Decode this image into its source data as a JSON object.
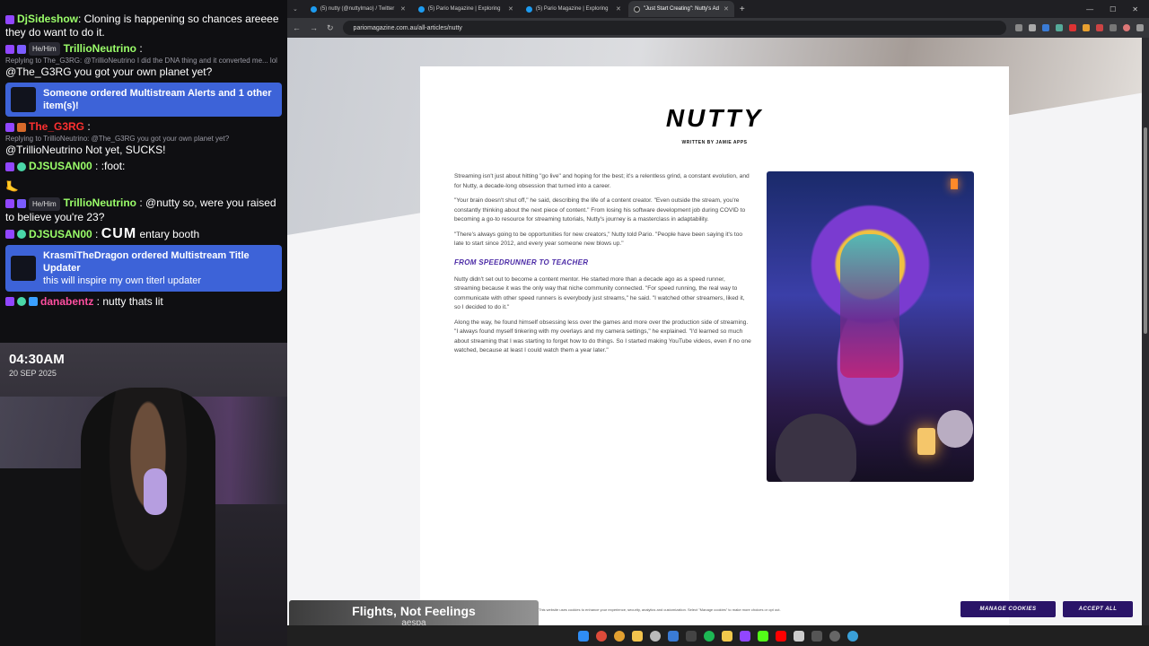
{
  "chat": {
    "messages": [
      {
        "name": "DjSideshow",
        "name_color": "#9bff6a",
        "text": ": Cloning is happening so chances areeee they do want to do it."
      },
      {
        "name": "TrillioNeutrino",
        "name_color": "#9bff6a",
        "pronoun": "He/Him",
        "text": " :"
      },
      {
        "reply": "Replying to The_G3RG: @TrillioNeutrino I did the DNA thing and it converted me... lol",
        "text": "@The_G3RG you got your own planet yet?"
      },
      {
        "name": "The_G3RG",
        "name_color": "#ff3030",
        "text": " :",
        "reply_after": "Replying to TrillioNeutrino: @The_G3RG you got your own planet yet?",
        "text2": "@TrillioNeutrino Not yet, SUCKS!"
      },
      {
        "name": "DJSUSAN00",
        "name_color": "#9bff6a",
        "text": " : :foot:"
      },
      {
        "name": "TrillioNeutrino",
        "name_color": "#9bff6a",
        "pronoun": "He/Him",
        "text": " : @nutty so, were you raised to believe you're 23?"
      },
      {
        "name": "DJSUSAN00",
        "name_color": "#9bff6a",
        "emote": "CUM",
        "text": " entary booth"
      },
      {
        "name": "danabentz",
        "name_color": "#ff4fa0",
        "text": " : nutty thats lit"
      }
    ],
    "alerts": [
      {
        "title": "Someone ordered Multistream Alerts and 1 other item(s)!",
        "sub": ""
      },
      {
        "title": "KrasmiTheDragon ordered Multistream Title Updater",
        "sub": "this will inspire my own titerl updater"
      }
    ]
  },
  "cam": {
    "time": "04:30AM",
    "date": "20 SEP 2025"
  },
  "song": {
    "title": "Flights, Not Feelings",
    "artist": "aespa"
  },
  "browser": {
    "tabs": [
      {
        "label": "(5) nutty (@nuttylmao) / Twitter",
        "active": false
      },
      {
        "label": "(5) Pario Magazine | Exploring",
        "active": false
      },
      {
        "label": "(5) Pario Magazine | Exploring",
        "active": false
      },
      {
        "label": "\"Just Start Creating\": Nutty's Ad",
        "active": true
      }
    ],
    "url": "pariomagazine.com.au/all-articles/nutty"
  },
  "article": {
    "title": "NUTTY",
    "byline": "WRITTEN BY JAMIE APPS",
    "paragraphs_1": [
      "Streaming isn't just about hitting \"go live\" and hoping for the best; it's a relentless grind, a constant evolution, and for Nutty, a decade-long obsession that turned into a career.",
      "\"Your brain doesn't shut off,\" he said, describing the life of a content creator. \"Even outside the stream, you're constantly thinking about the next piece of content.\" From losing his software development job during COVID to becoming a go-to resource for streaming tutorials, Nutty's journey is a masterclass in adaptability.",
      "\"There's always going to be opportunities for new creators,\" Nutty told Pario. \"People have been saying it's too late to start since 2012, and every year someone new blows up.\""
    ],
    "subhead": "FROM SPEEDRUNNER TO TEACHER",
    "paragraphs_2": [
      "Nutty didn't set out to become a content mentor. He started more than a decade ago as a speed runner, streaming because it was the only way that niche community connected. \"For speed running, the real way to communicate with other speed runners is everybody just streams,\" he said. \"I watched other streamers, liked it, so I decided to do it.\"",
      "Along the way, he found himself obsessing less over the games and more over the production side of streaming. \"I always found myself tinkering with my overlays and my camera settings,\" he explained. \"I'd learned so much about streaming that I was starting to forget how to do things. So I started making YouTube videos, even if no one watched, because at least I could watch them a year later.\""
    ]
  },
  "cookie": {
    "message": "This website uses cookies to enhance your experience, security, analytics and customization. Select \"Manage cookies\" to make more choices or opt out.",
    "manage_label": "MANAGE COOKIES",
    "accept_label": "ACCEPT ALL"
  }
}
